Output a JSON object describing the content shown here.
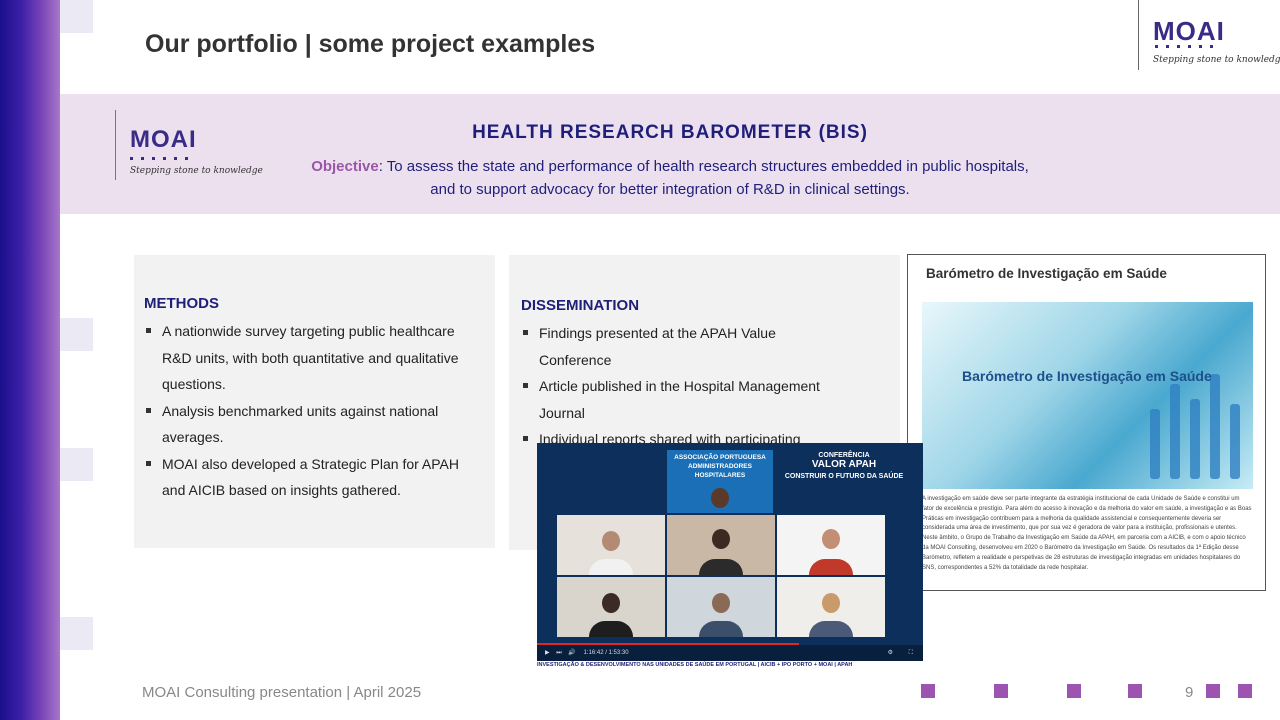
{
  "slide": {
    "title": "Our portfolio | some project examples",
    "page_number": "9"
  },
  "logo": {
    "name": "MOAI",
    "tagline": "Stepping stone to knowledge"
  },
  "project": {
    "title": "HEALTH RESEARCH BAROMETER (BIS)",
    "objective_label": "Objective",
    "objective_text_line1": ": To assess the state and performance of health research structures  embedded in public hospitals,",
    "objective_text_line2": "and to support advocacy for better integration of R&D in clinical settings."
  },
  "methods": {
    "heading": "METHODS",
    "items": [
      "A nationwide survey targeting public healthcare R&D units, with both quantitative and qualitative questions.",
      "Analysis benchmarked units against national averages.",
      "MOAI also developed a Strategic Plan for APAH and AICIB  based on insights gathered."
    ]
  },
  "dissemination": {
    "heading": "DISSEMINATION",
    "items": [
      "Findings presented at the APAH Value Conference",
      "Article published in the Hospital Management Journal",
      "Individual reports shared with participating hospitals"
    ]
  },
  "article": {
    "title": "Barómetro de Investigação em Saúde",
    "image_text": "Barómetro de Investigação em Saúde",
    "body": "A investigação em saúde deve ser parte integrante da estratégia institucional de cada Unidade de Saúde e constitui um fator de excelência e prestígio. Para além do acesso à inovação e da melhoria do valor em saúde, a investigação e as Boas Práticas em investigação contribuem para a melhoria da qualidade assistencial e consequentemente deveria ser considerada uma área de investimento, que por sua vez é geradora de valor para a instituição, profissionais e utentes. Neste âmbito, o Grupo de Trabalho da Investigação em Saúde da APAH, em parceria com a AICIB, e com o apoio técnico da MOAI Consulting, desenvolveu em 2020 o Barómetro da Investigação em Saúde. Os resultados da 1ª Edição desse Barómetro, refletem a realidade e perspetivas de 28 estruturas de investigação integradas em unidades hospitalares do SNS, correspondentes a 52% da totalidade da rede hospitalar."
  },
  "video": {
    "banner": "ASSOCIAÇÃO PORTUGUESA ADMINISTRADORES HOSPITALARES",
    "conference_line1": "CONFERÊNCIA",
    "conference_line2": "VALOR APAH",
    "conference_line3": "CONSTRUIR O FUTURO DA SAÚDE",
    "time": "1:16:42 / 1:53:30",
    "progress": 0.68,
    "caption": "INVESTIGAÇÃO & DESENVOLVIMENTO NAS UNIDADES DE SAÚDE EM PORTUGAL | AICIB + IPO PORTO + MOAI | APAH"
  },
  "footer": {
    "text": "MOAI Consulting  presentation | April 2025"
  },
  "colors": {
    "accent": "#1f1f7a",
    "highlight": "#9a57a8",
    "band": "#ece0ef",
    "footer_square": "#9c54b0"
  }
}
